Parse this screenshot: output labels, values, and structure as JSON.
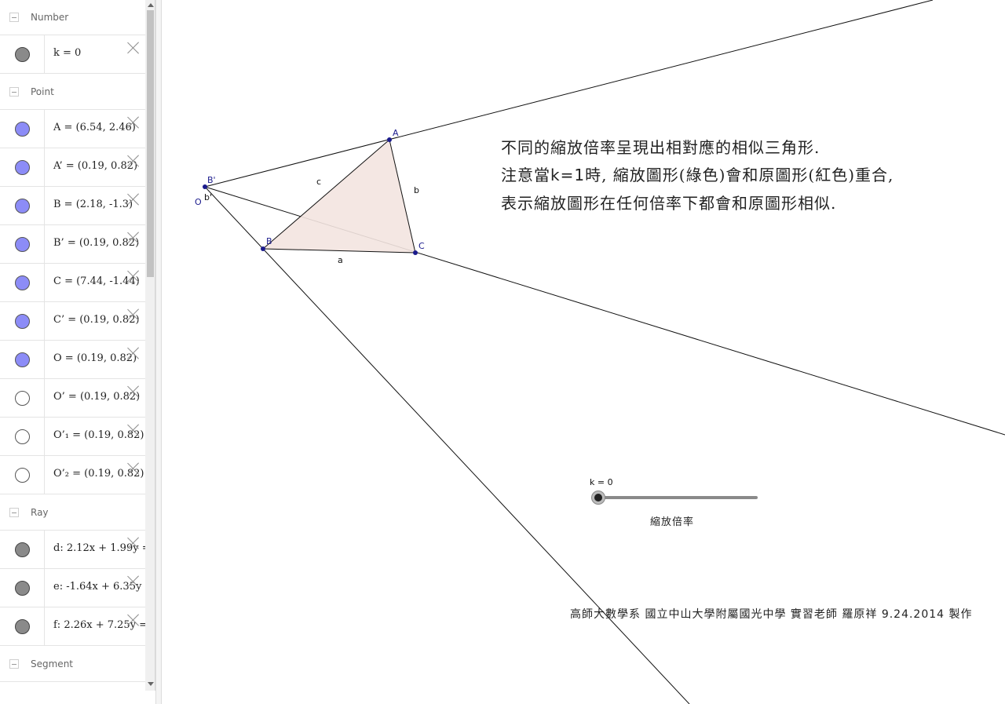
{
  "algebra": {
    "groups": [
      {
        "name": "Number",
        "items": [
          {
            "label": "k = 0",
            "marble": "grey",
            "color": "#8a8a8a"
          }
        ]
      },
      {
        "name": "Point",
        "items": [
          {
            "label": "A = (6.54, 2.46)",
            "marble": "blue"
          },
          {
            "label": "A’ = (0.19, 0.82)",
            "marble": "blue"
          },
          {
            "label": "B = (2.18, -1.3)",
            "marble": "blue"
          },
          {
            "label": "B’ = (0.19, 0.82)",
            "marble": "blue"
          },
          {
            "label": "C = (7.44, -1.44)",
            "marble": "blue"
          },
          {
            "label": "C’ = (0.19, 0.82)",
            "marble": "blue"
          },
          {
            "label": "O = (0.19, 0.82)",
            "marble": "blue"
          },
          {
            "label": "O’ = (0.19, 0.82)",
            "marble": "empty"
          },
          {
            "label": "O’₁ = (0.19, 0.82)",
            "marble": "empty"
          },
          {
            "label": "O’₂ = (0.19, 0.82)",
            "marble": "empty"
          }
        ]
      },
      {
        "name": "Ray",
        "items": [
          {
            "label": "d: 2.12x + 1.99y = ",
            "marble": "grey"
          },
          {
            "label": "e: -1.64x + 6.35y = ",
            "marble": "grey"
          },
          {
            "label": "f: 2.26x + 7.25y = ",
            "marble": "grey"
          }
        ]
      },
      {
        "name": "Segment",
        "items": []
      }
    ]
  },
  "graphics": {
    "points": {
      "A": "A",
      "B": "B",
      "C": "C",
      "O": "O",
      "A_prime": "B'",
      "b_prime": "b'"
    },
    "sides": {
      "a": "a",
      "b": "b",
      "c": "c"
    },
    "note": {
      "line1": "不同的縮放倍率呈現出相對應的相似三角形.",
      "line2_pre": "注意當",
      "line2_k": "k=1",
      "line2_post": "時, 縮放圖形(綠色)會和原圖形(紅色)重合,",
      "line3": "表示縮放圖形在任何倍率下都會和原圖形相似."
    },
    "slider": {
      "label": "k = 0",
      "caption": "縮放倍率",
      "value": 0,
      "min": 0,
      "max": 1
    },
    "credit": {
      "pre": "高師大數學系 國立中山大學附屬國光中學 實習老師 羅原祥 ",
      "date": "9.24.2014",
      "post": " 製作"
    },
    "colors": {
      "point": "#1a1a8c",
      "triangle_fill": "#f3e4e0",
      "line": "#111111"
    }
  }
}
